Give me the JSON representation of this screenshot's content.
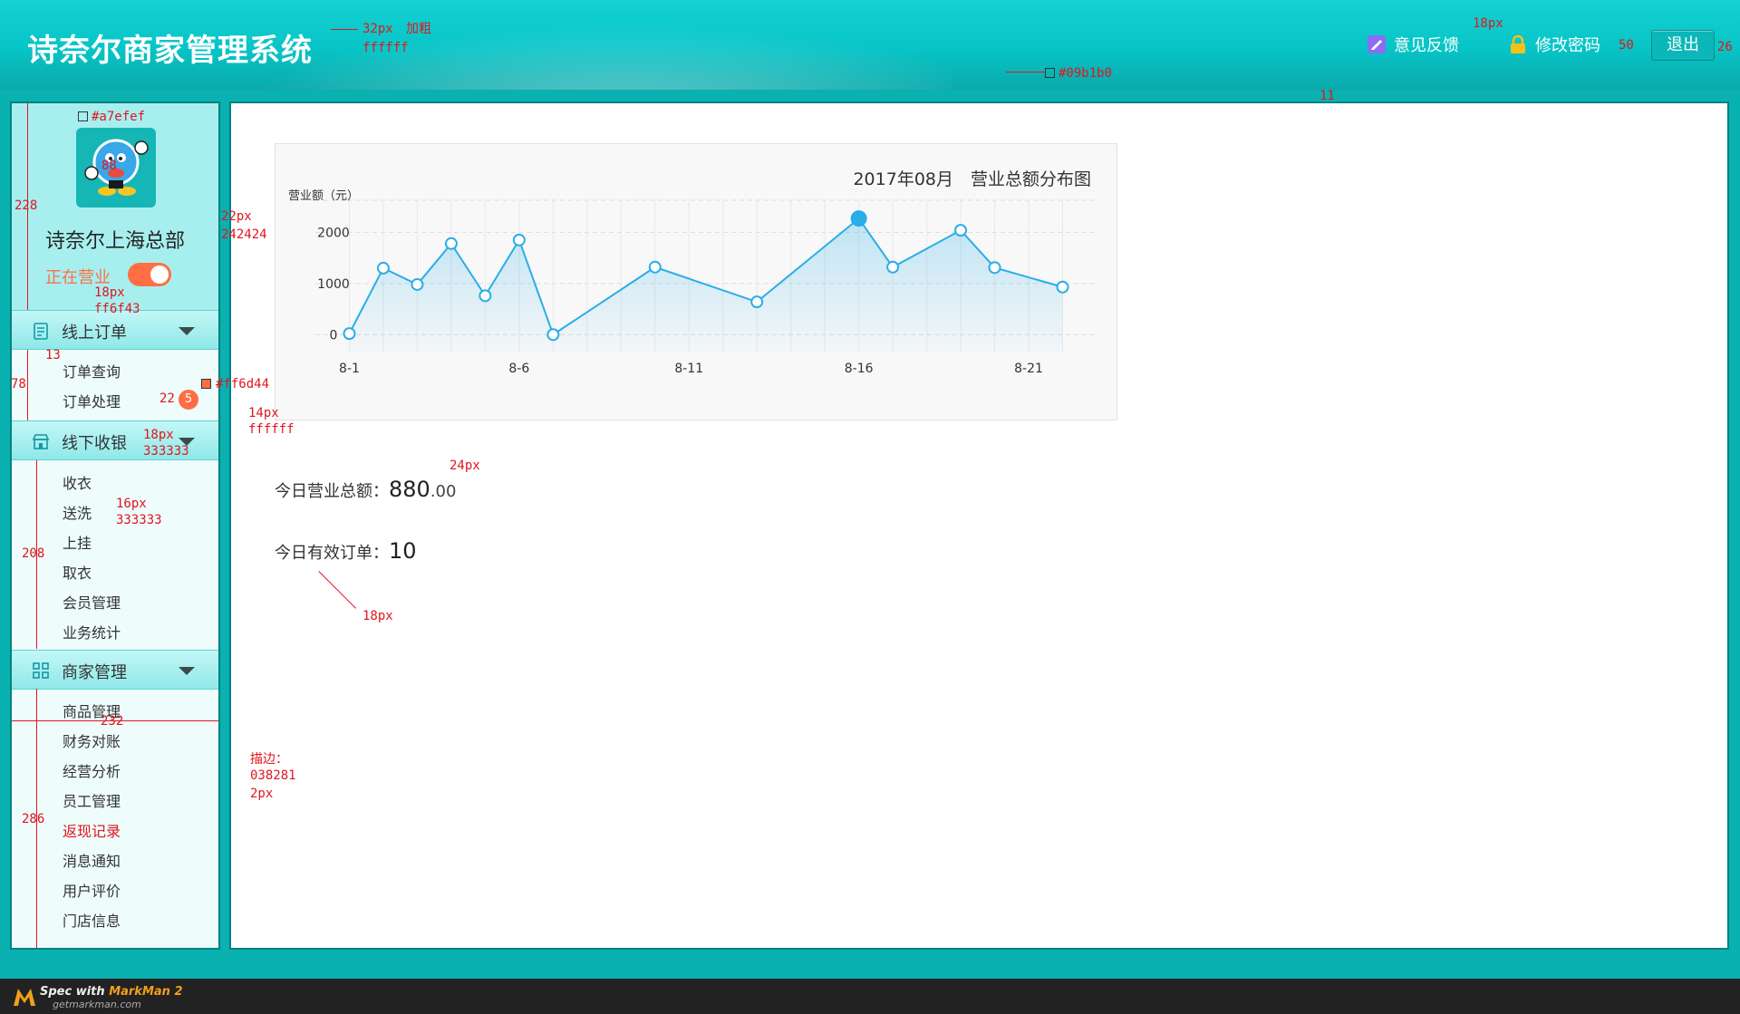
{
  "header": {
    "title": "诗奈尔商家管理系统",
    "feedback_label": "意见反馈",
    "change_password_label": "修改密码",
    "logout_label": "退出"
  },
  "sidebar": {
    "store_name": "诗奈尔上海总部",
    "status_label": "正在营业",
    "status_on": true,
    "sections": [
      {
        "title": "线上订单",
        "items": [
          "订单查询",
          "订单处理"
        ]
      },
      {
        "title": "线下收银",
        "items": [
          "收衣",
          "送洗",
          "上挂",
          "取衣",
          "会员管理",
          "业务统计"
        ]
      },
      {
        "title": "商家管理",
        "items": [
          "商品管理",
          "财务对账",
          "经营分析",
          "员工管理",
          "返现记录",
          "消息通知",
          "用户评价",
          "门店信息"
        ]
      }
    ],
    "order_badge": "5",
    "active_item": "返现记录"
  },
  "chart_data": {
    "type": "area",
    "title": "2017年08月　营业总额分布图",
    "ylabel": "营业额（元）",
    "xlabel": "",
    "x_ticks": [
      "8-1",
      "8-6",
      "8-11",
      "8-16",
      "8-21"
    ],
    "x_tick_days": [
      1,
      6,
      11,
      16,
      21
    ],
    "x": [
      1,
      2,
      3,
      4,
      5,
      6,
      7,
      10,
      13,
      16,
      17,
      19,
      20,
      22
    ],
    "values": [
      20,
      1300,
      980,
      1780,
      760,
      1850,
      0,
      1320,
      640,
      2270,
      1320,
      2040,
      1310,
      930
    ],
    "highlight_index": 9,
    "yticks": [
      0,
      1000,
      2000
    ],
    "ylim": [
      -350,
      2450
    ],
    "grid": true,
    "legend": "none"
  },
  "summary": {
    "revenue_label": "今日营业总额：",
    "revenue_int": "880",
    "revenue_dec": ".00",
    "orders_label": "今日有效订单：",
    "orders_value": "10"
  },
  "annotations": {
    "title_size": "32px",
    "title_bold": "加粗",
    "title_color": "ffffff",
    "hdr_link_size": "18px",
    "gap_50": "50",
    "gap_26": "26",
    "header_bg": "#09b1b0",
    "gap_11": "11",
    "profile_bg": "#a7efef",
    "profile_h": "228",
    "avatar_size": "88",
    "store_size": "22px",
    "store_color": "242424",
    "status_size": "18px",
    "status_color": "ff6f43",
    "gap_13": "13",
    "sec1_h": "78",
    "badge_size": "22",
    "badge_color": "#ff6d44",
    "badge_text_size": "14px",
    "badge_text_color": "ffffff",
    "sec_size": "18px",
    "sec_color": "333333",
    "item_size": "16px",
    "item_color": "333333",
    "sec2_h": "208",
    "sidebar_w": "232",
    "stroke_label": "描边：",
    "stroke_color": "038281",
    "stroke_w": "2px",
    "sec3_h": "286",
    "revenue_size": "24px",
    "orders_size": "18px"
  },
  "footer": {
    "spec_prefix": "Spec with ",
    "spec_brand": "MarkMan 2",
    "site": "getmarkman.com"
  },
  "colors": {
    "teal": "#09b1b0",
    "stroke": "#038281",
    "profile_bg": "#a7efef",
    "accent_orange": "#ff6f43",
    "badge": "#ff6d44",
    "chart_line": "#2aaee8"
  }
}
